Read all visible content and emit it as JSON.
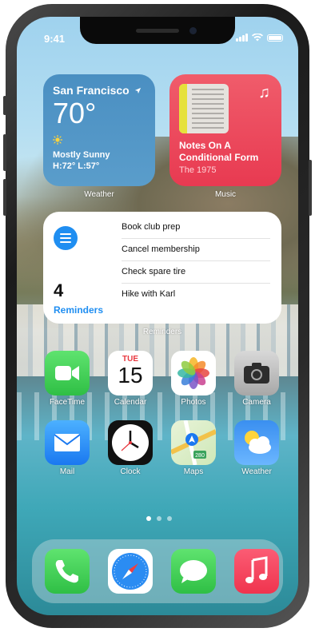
{
  "status_bar": {
    "time": "9:41"
  },
  "widgets": {
    "weather": {
      "city": "San Francisco",
      "temperature": "70°",
      "condition": "Mostly Sunny",
      "high_low": "H:72° L:57°",
      "label": "Weather"
    },
    "music": {
      "title": "Notes On A Conditional Form",
      "artist": "The 1975",
      "label": "Music"
    },
    "reminders": {
      "count": "4",
      "title": "Reminders",
      "items": [
        "Book club prep",
        "Cancel membership",
        "Check spare tire",
        "Hike with Karl"
      ],
      "label": "Reminders"
    }
  },
  "apps": [
    {
      "name": "FaceTime",
      "icon": "facetime-icon"
    },
    {
      "name": "Calendar",
      "icon": "calendar-icon",
      "day": "TUE",
      "date": "15"
    },
    {
      "name": "Photos",
      "icon": "photos-icon"
    },
    {
      "name": "Camera",
      "icon": "camera-icon"
    },
    {
      "name": "Mail",
      "icon": "mail-icon"
    },
    {
      "name": "Clock",
      "icon": "clock-icon"
    },
    {
      "name": "Maps",
      "icon": "maps-icon",
      "badge": "280"
    },
    {
      "name": "Weather",
      "icon": "weather-icon"
    }
  ],
  "page_dots": {
    "count": 3,
    "active": 1
  },
  "dock": [
    {
      "icon": "phone-icon"
    },
    {
      "icon": "safari-icon"
    },
    {
      "icon": "messages-icon"
    },
    {
      "icon": "music-icon"
    }
  ],
  "colors": {
    "reminders_blue": "#1f8ef1",
    "music_red": "#e83a51",
    "weather_blue": "#4a8fc2"
  }
}
